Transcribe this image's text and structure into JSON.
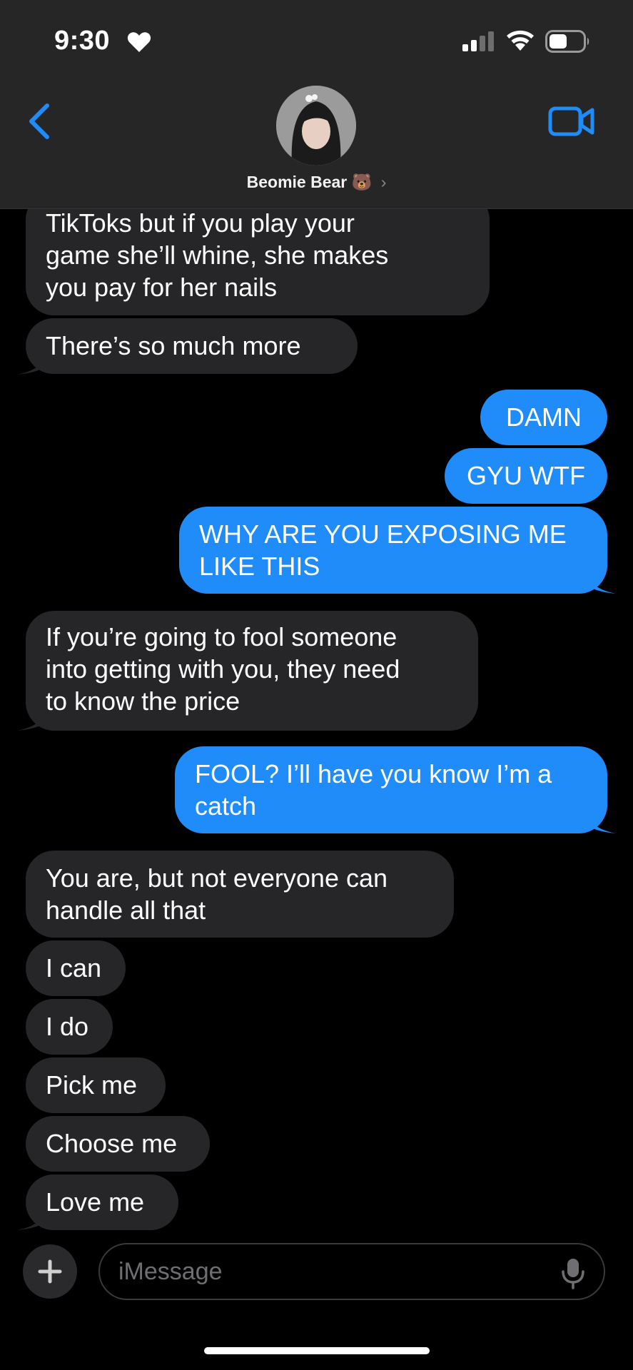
{
  "status_bar": {
    "time": "9:30"
  },
  "header": {
    "contact_name": "Beomie Bear",
    "contact_emoji": "🐻",
    "chevron": "›"
  },
  "messages": [
    {
      "direction": "in",
      "text": "TikToks but if you play your\ngame she’ll whine, she makes\nyou pay for her nails"
    },
    {
      "direction": "in",
      "text": "There’s so much more"
    },
    {
      "direction": "out",
      "text": "DAMN"
    },
    {
      "direction": "out",
      "text": "GYU WTF"
    },
    {
      "direction": "out",
      "text": "WHY ARE YOU EXPOSING ME\nLIKE THIS"
    },
    {
      "direction": "in",
      "text": "If you’re going to fool someone\ninto getting with you, they need\nto know the price"
    },
    {
      "direction": "out",
      "text": "FOOL? I’ll have you know I’m a\ncatch"
    },
    {
      "direction": "in",
      "text": "You are, but not everyone can\nhandle all that"
    },
    {
      "direction": "in",
      "text": "I can"
    },
    {
      "direction": "in",
      "text": "I do"
    },
    {
      "direction": "in",
      "text": "Pick me"
    },
    {
      "direction": "in",
      "text": "Choose me"
    },
    {
      "direction": "in",
      "text": "Love me"
    }
  ],
  "composer": {
    "placeholder": "iMessage"
  },
  "icons": {
    "back": "chevron-left-icon",
    "video": "video-camera-icon",
    "plus": "plus-icon",
    "mic": "microphone-icon",
    "heart": "heart-icon"
  },
  "colors": {
    "accent": "#1f8cfa",
    "incoming_bubble": "#262628",
    "outgoing_bubble": "#1f8cfa",
    "header_bg": "#262626",
    "background": "#000000"
  }
}
